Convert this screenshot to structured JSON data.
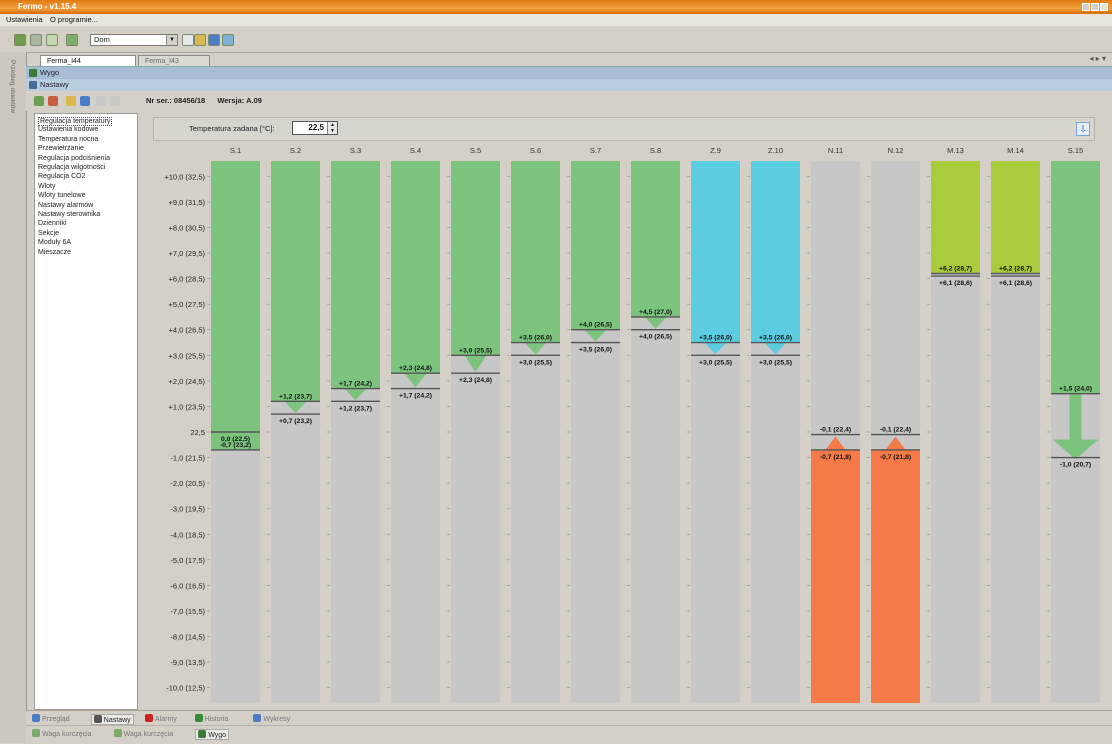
{
  "window": {
    "title": "Fermo - v1.15.4"
  },
  "menu": [
    "Ustawienia",
    "O programie..."
  ],
  "toolbar": {
    "combo_value": "Dom"
  },
  "side_strip_label": "Przebieg obiektów",
  "tabs": [
    {
      "label": "Ferma_I44",
      "active": true
    },
    {
      "label": "Ferma_I43",
      "active": false
    }
  ],
  "bands": {
    "top": "Wygo",
    "sub": "Nastawy"
  },
  "info": {
    "serial_label": "Nr ser.: 08456/18",
    "version_label": "Wersja: A.09"
  },
  "nav_items": [
    "Regulacja temperatury",
    "Ustawienia kodowe",
    "Temperatura nocna",
    "Przewietrzanie",
    "Regulacja podciśnienia",
    "Regulacja wilgotności",
    "Regulacja CO2",
    "Wloty",
    "Wloty tunelowe",
    "Nastawy alarmów",
    "Nastawy sterownika",
    "Dzienniki",
    "Sekcje",
    "Moduły 6A",
    "Mieszacze"
  ],
  "nav_selected": 0,
  "set_temperature": {
    "label": "Temperatura zadana [°C]:",
    "value": "22,5"
  },
  "chart_data": {
    "type": "bar",
    "y_ticks": [
      {
        "v": 10,
        "label": "+10,0 (32,5)"
      },
      {
        "v": 9,
        "label": "+9,0 (31,5)"
      },
      {
        "v": 8,
        "label": "+8,0 (30,5)"
      },
      {
        "v": 7,
        "label": "+7,0 (29,5)"
      },
      {
        "v": 6,
        "label": "+6,0 (28,5)"
      },
      {
        "v": 5,
        "label": "+5,0 (27,5)"
      },
      {
        "v": 4,
        "label": "+4,0 (26,5)"
      },
      {
        "v": 3,
        "label": "+3,0 (25,5)"
      },
      {
        "v": 2,
        "label": "+2,0 (24,5)"
      },
      {
        "v": 1,
        "label": "+1,0 (23,5)"
      },
      {
        "v": 0,
        "label": "22,5"
      },
      {
        "v": -1,
        "label": "-1,0 (21,5)"
      },
      {
        "v": -2,
        "label": "-2,0 (20,5)"
      },
      {
        "v": -3,
        "label": "-3,0 (19,5)"
      },
      {
        "v": -4,
        "label": "-4,0 (18,5)"
      },
      {
        "v": -5,
        "label": "-5,0 (17,5)"
      },
      {
        "v": -6,
        "label": "-6,0 (16,5)"
      },
      {
        "v": -7,
        "label": "-7,0 (15,5)"
      },
      {
        "v": -8,
        "label": "-8,0 (14,5)"
      },
      {
        "v": -9,
        "label": "-9,0 (13,5)"
      },
      {
        "v": -10,
        "label": "-10,0 (12,5)"
      }
    ],
    "ylim": [
      -10.6,
      10.6
    ],
    "columns": [
      {
        "name": "S.1",
        "color": "#7cc47e",
        "kind": "up",
        "start": -0.7,
        "stop": 0,
        "start_label": "-0,7 (23,2)",
        "stop_label": "0,0 (22,5)"
      },
      {
        "name": "S.2",
        "color": "#7cc47e",
        "kind": "up",
        "start": 1.2,
        "stop": 0.7,
        "start_label": "+1,2 (23,7)",
        "stop_label": "+0,7 (23,2)"
      },
      {
        "name": "S.3",
        "color": "#7cc47e",
        "kind": "up",
        "start": 1.7,
        "stop": 1.2,
        "start_label": "+1,7 (24,2)",
        "stop_label": "+1,2 (23,7)"
      },
      {
        "name": "S.4",
        "color": "#7cc47e",
        "kind": "up",
        "start": 2.3,
        "stop": 1.7,
        "start_label": "+2,3 (24,8)",
        "stop_label": "+1,7 (24,2)"
      },
      {
        "name": "S.5",
        "color": "#7cc47e",
        "kind": "up",
        "start": 3.0,
        "stop": 2.3,
        "start_label": "+3,0 (25,5)",
        "stop_label": "+2,3 (24,8)"
      },
      {
        "name": "S.6",
        "color": "#7cc47e",
        "kind": "up",
        "start": 3.5,
        "stop": 3.0,
        "start_label": "+3,5 (26,0)",
        "stop_label": "+3,0 (25,5)"
      },
      {
        "name": "S.7",
        "color": "#7cc47e",
        "kind": "up",
        "start": 4.0,
        "stop": 3.5,
        "start_label": "+4,0 (26,5)",
        "stop_label": "+3,5 (26,0)"
      },
      {
        "name": "S.8",
        "color": "#7cc47e",
        "kind": "up",
        "start": 4.5,
        "stop": 4.0,
        "start_label": "+4,5 (27,0)",
        "stop_label": "+4,0 (26,5)"
      },
      {
        "name": "Z.9",
        "color": "#5ccde0",
        "kind": "up",
        "start": 3.5,
        "stop": 3.0,
        "start_label": "+3,5 (26,0)",
        "stop_label": "+3,0 (25,5)"
      },
      {
        "name": "Z.10",
        "color": "#5ccde0",
        "kind": "up",
        "start": 3.5,
        "stop": 3.0,
        "start_label": "+3,5 (26,0)",
        "stop_label": "+3,0 (25,5)"
      },
      {
        "name": "N.11",
        "color": "#f57a48",
        "kind": "down",
        "start": -0.1,
        "stop": -0.7,
        "start_label": "-0,1 (22,4)",
        "stop_label": "-0,7 (21,8)"
      },
      {
        "name": "N.12",
        "color": "#f57a48",
        "kind": "down",
        "start": -0.1,
        "stop": -0.7,
        "start_label": "-0,1 (22,4)",
        "stop_label": "-0,7 (21,8)"
      },
      {
        "name": "M.13",
        "color": "#a8cc3c",
        "kind": "flat",
        "start": 6.2,
        "stop": 6.1,
        "start_label": "+6,2 (28,7)",
        "stop_label": "+6,1 (28,6)"
      },
      {
        "name": "M.14",
        "color": "#a8cc3c",
        "kind": "flat",
        "start": 6.2,
        "stop": 6.1,
        "start_label": "+6,2 (28,7)",
        "stop_label": "+6,1 (28,6)"
      },
      {
        "name": "S.15",
        "color": "#7cc47e",
        "kind": "range",
        "start": 1.5,
        "stop": -1.0,
        "start_label": "+1,5 (24,0)",
        "stop_label": "-1,0 (20,7)"
      }
    ]
  },
  "statusbar": [
    "Przegląd",
    "Nastawy",
    "Alarmy",
    "Historia",
    "Wykresy"
  ],
  "statusbar_active": 1,
  "statusbar2": [
    "Waga kurczęcia",
    "Waga kurczęcia",
    "Wygo"
  ],
  "statusbar2_active": 2
}
